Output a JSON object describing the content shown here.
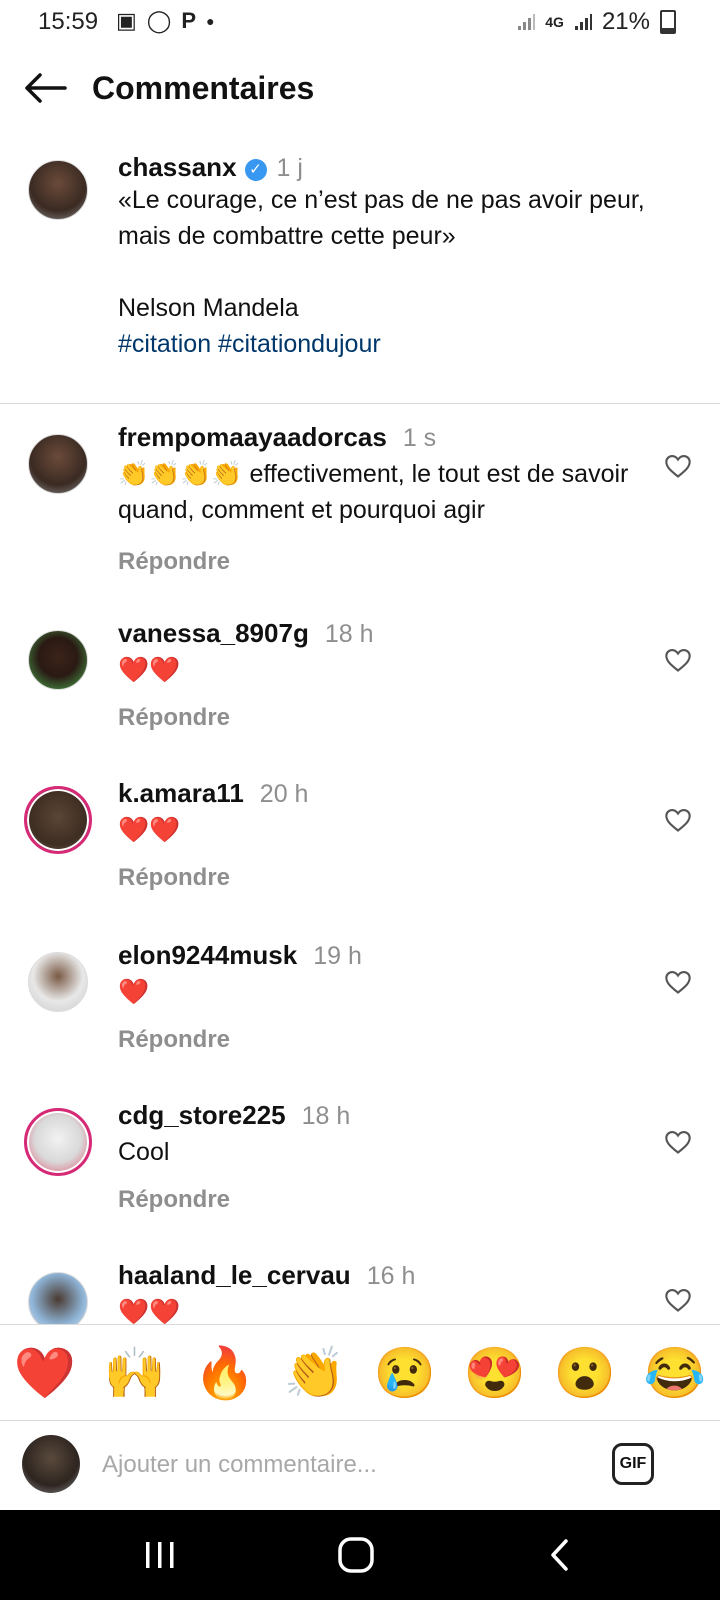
{
  "status_bar": {
    "time": "15:59",
    "network": "4G",
    "battery": "21%"
  },
  "header": {
    "title": "Commentaires"
  },
  "post": {
    "username": "chassanx",
    "time": "1 j",
    "text": "«Le courage, ce n’est pas de ne pas avoir peur, mais de combattre cette peur»\n\nNelson Mandela",
    "hashtags": "#citation #citationdujour"
  },
  "comments": [
    {
      "username": "frempomaayaadorcas",
      "time": "1 s",
      "text": "👏👏👏👏 effectivement,  le tout est de savoir quand, comment et pourquoi agir",
      "reply": "Répondre"
    },
    {
      "username": "vanessa_8907g",
      "time": "18 h",
      "text": "❤️❤️",
      "reply": "Répondre"
    },
    {
      "username": "k.amara11",
      "time": "20 h",
      "text": "❤️❤️",
      "reply": "Répondre"
    },
    {
      "username": "elon9244musk",
      "time": "19 h",
      "text": "❤️",
      "reply": "Répondre"
    },
    {
      "username": "cdg_store225",
      "time": "18 h",
      "text": "Cool",
      "reply": "Répondre"
    },
    {
      "username": "haaland_le_cervau",
      "time": "16 h",
      "text": "❤️❤️",
      "reply": ""
    }
  ],
  "reactions": [
    "❤️",
    "🙌",
    "🔥",
    "👏",
    "😢",
    "😍",
    "😮",
    "😂"
  ],
  "input": {
    "placeholder": "Ajouter un commentaire...",
    "gif_label": "GIF"
  },
  "colors": {
    "hashtag": "#00376b",
    "muted": "#8e8e8e",
    "verified": "#3897f0",
    "story_ring": "#d62976"
  }
}
